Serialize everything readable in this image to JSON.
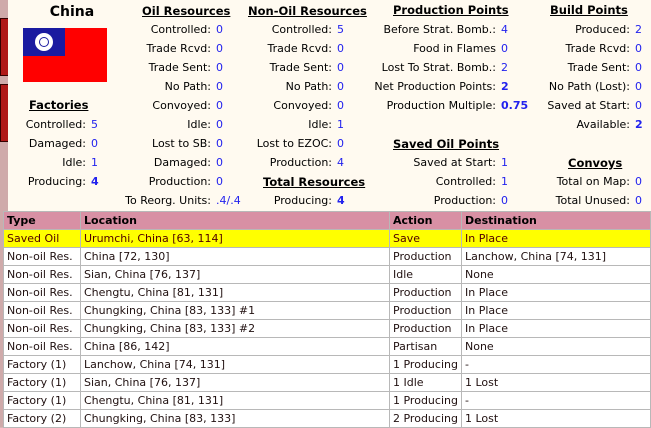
{
  "country": "China",
  "factories": {
    "title": "Factories",
    "rows": [
      [
        "Controlled:",
        "5"
      ],
      [
        "Damaged:",
        "0"
      ],
      [
        "Idle:",
        "1"
      ],
      [
        "Producing:",
        "4"
      ]
    ]
  },
  "oil": {
    "title": "Oil Resources",
    "rows": [
      [
        "Controlled:",
        "0"
      ],
      [
        "Trade Rcvd:",
        "0"
      ],
      [
        "Trade Sent:",
        "0"
      ],
      [
        "No Path:",
        "0"
      ],
      [
        "Convoyed:",
        "0"
      ],
      [
        "Idle:",
        "0"
      ],
      [
        "Lost to SB:",
        "0"
      ],
      [
        "Damaged:",
        "0"
      ],
      [
        "Production:",
        "0"
      ],
      [
        "To Reorg. Units:",
        ".4/.4"
      ]
    ]
  },
  "nonoil": {
    "title": "Non-Oil Resources",
    "rows": [
      [
        "Controlled:",
        "5"
      ],
      [
        "Trade Rcvd:",
        "0"
      ],
      [
        "Trade Sent:",
        "0"
      ],
      [
        "No Path:",
        "0"
      ],
      [
        "Convoyed:",
        "0"
      ],
      [
        "Idle:",
        "1"
      ],
      [
        "Lost to EZOC:",
        "0"
      ],
      [
        "Production:",
        "4"
      ]
    ]
  },
  "total": {
    "title": "Total Resources",
    "rows": [
      [
        "Producing:",
        "4"
      ]
    ]
  },
  "production": {
    "title": "Production Points",
    "rows": [
      [
        "Before Strat. Bomb.:",
        "4"
      ],
      [
        "Food in Flames",
        "0"
      ],
      [
        "Lost To Strat. Bomb.:",
        "2"
      ],
      [
        "Net Production Points:",
        "2"
      ],
      [
        "Production Multiple:",
        "0.75"
      ]
    ]
  },
  "build": {
    "title": "Build Points",
    "rows": [
      [
        "Produced:",
        "2"
      ],
      [
        "Trade Rcvd:",
        "0"
      ],
      [
        "Trade Sent:",
        "0"
      ],
      [
        "No Path (Lost):",
        "0"
      ],
      [
        "Saved at Start:",
        "0"
      ],
      [
        "Available:",
        "2"
      ]
    ]
  },
  "savedoil": {
    "title": "Saved Oil Points",
    "rows": [
      [
        "Saved at Start:",
        "1"
      ],
      [
        "Controlled:",
        "1"
      ],
      [
        "Production:",
        "0"
      ]
    ]
  },
  "convoys": {
    "title": "Convoys",
    "rows": [
      [
        "Total on Map:",
        "0"
      ],
      [
        "Total Unused:",
        "0"
      ]
    ]
  },
  "table": {
    "headers": [
      "Type",
      "Location",
      "Action",
      "Destination"
    ],
    "rows": [
      [
        "Saved Oil",
        "Urumchi, China [63, 114]",
        "Save",
        "In Place"
      ],
      [
        "Non-oil Res.",
        "China [72, 130]",
        "Production",
        "Lanchow, China [74, 131]"
      ],
      [
        "Non-oil Res.",
        "Sian, China [76, 137]",
        "Idle",
        "None"
      ],
      [
        "Non-oil Res.",
        "Chengtu, China [81, 131]",
        "Production",
        "In Place"
      ],
      [
        "Non-oil Res.",
        "Chungking, China [83, 133] #1",
        "Production",
        "In Place"
      ],
      [
        "Non-oil Res.",
        "Chungking, China [83, 133] #2",
        "Production",
        "In Place"
      ],
      [
        "Non-oil Res.",
        "China [86, 142]",
        "Partisan",
        "None"
      ],
      [
        "Factory (1)",
        "Lanchow, China [74, 131]",
        "1 Producing",
        "-"
      ],
      [
        "Factory (1)",
        "Sian, China [76, 137]",
        "1 Idle",
        "1 Lost"
      ],
      [
        "Factory (1)",
        "Chengtu, China [81, 131]",
        "1 Producing",
        "-"
      ],
      [
        "Factory (2)",
        "Chungking, China [83, 133]",
        "2 Producing",
        "1 Lost"
      ]
    ]
  }
}
